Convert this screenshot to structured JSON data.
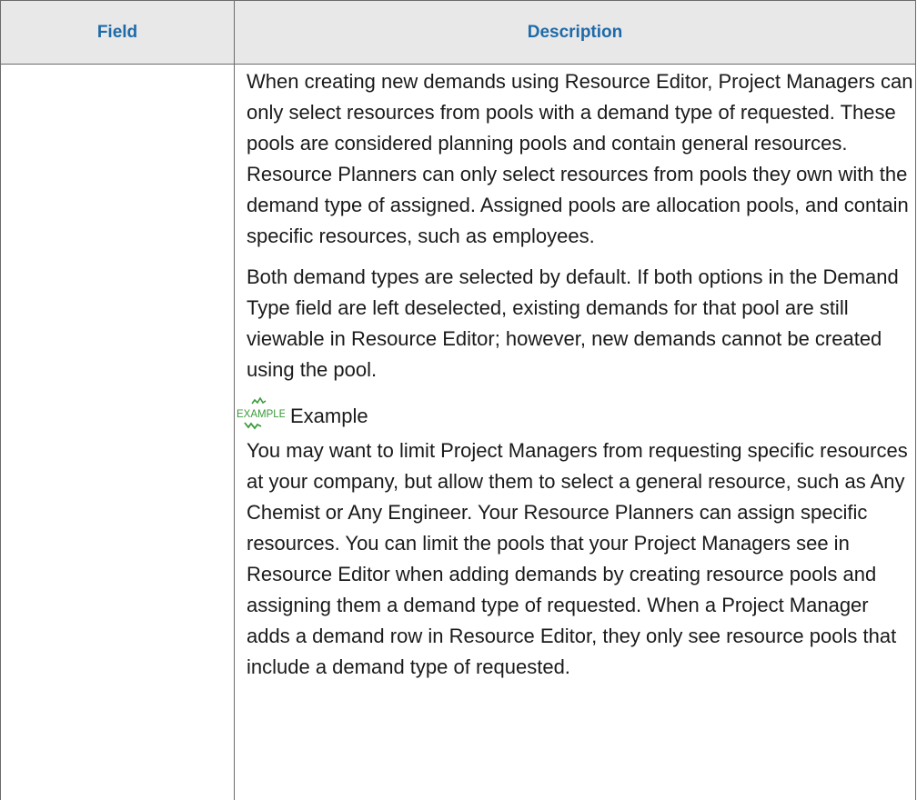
{
  "table": {
    "headers": {
      "field": "Field",
      "description": "Description"
    },
    "row": {
      "field": "",
      "paragraphs": [
        "When creating new demands using Resource Editor, Project Managers can only select resources from pools with a demand type of requested. These pools are considered planning pools and contain general resources.  Resource Planners can only select resources from pools they own with the demand type of assigned. Assigned pools are allocation pools, and contain specific resources, such as employees.",
        "Both demand types are selected by default. If both options in the Demand Type field are left deselected, existing demands for that pool are still viewable in Resource Editor; however, new demands cannot be created using the pool."
      ],
      "example": {
        "icon_text": "EXAMPLE",
        "icon_name": "example-icon",
        "icon_color": "#3a9a3a",
        "label": "Example",
        "text": "You may want to limit Project Managers from requesting specific resources at your company, but allow them to select a general resource, such as Any Chemist or Any Engineer. Your Resource Planners can assign specific resources. You can limit the pools that your Project Managers see in Resource Editor when adding demands by creating resource pools and assigning them a demand type of requested. When a Project Manager adds a demand row in Resource Editor, they only see resource pools that include a demand type of requested."
      }
    }
  },
  "colors": {
    "header_text": "#1e6aa8",
    "header_bg": "#e8e8e8",
    "border": "#6b6b6b"
  }
}
